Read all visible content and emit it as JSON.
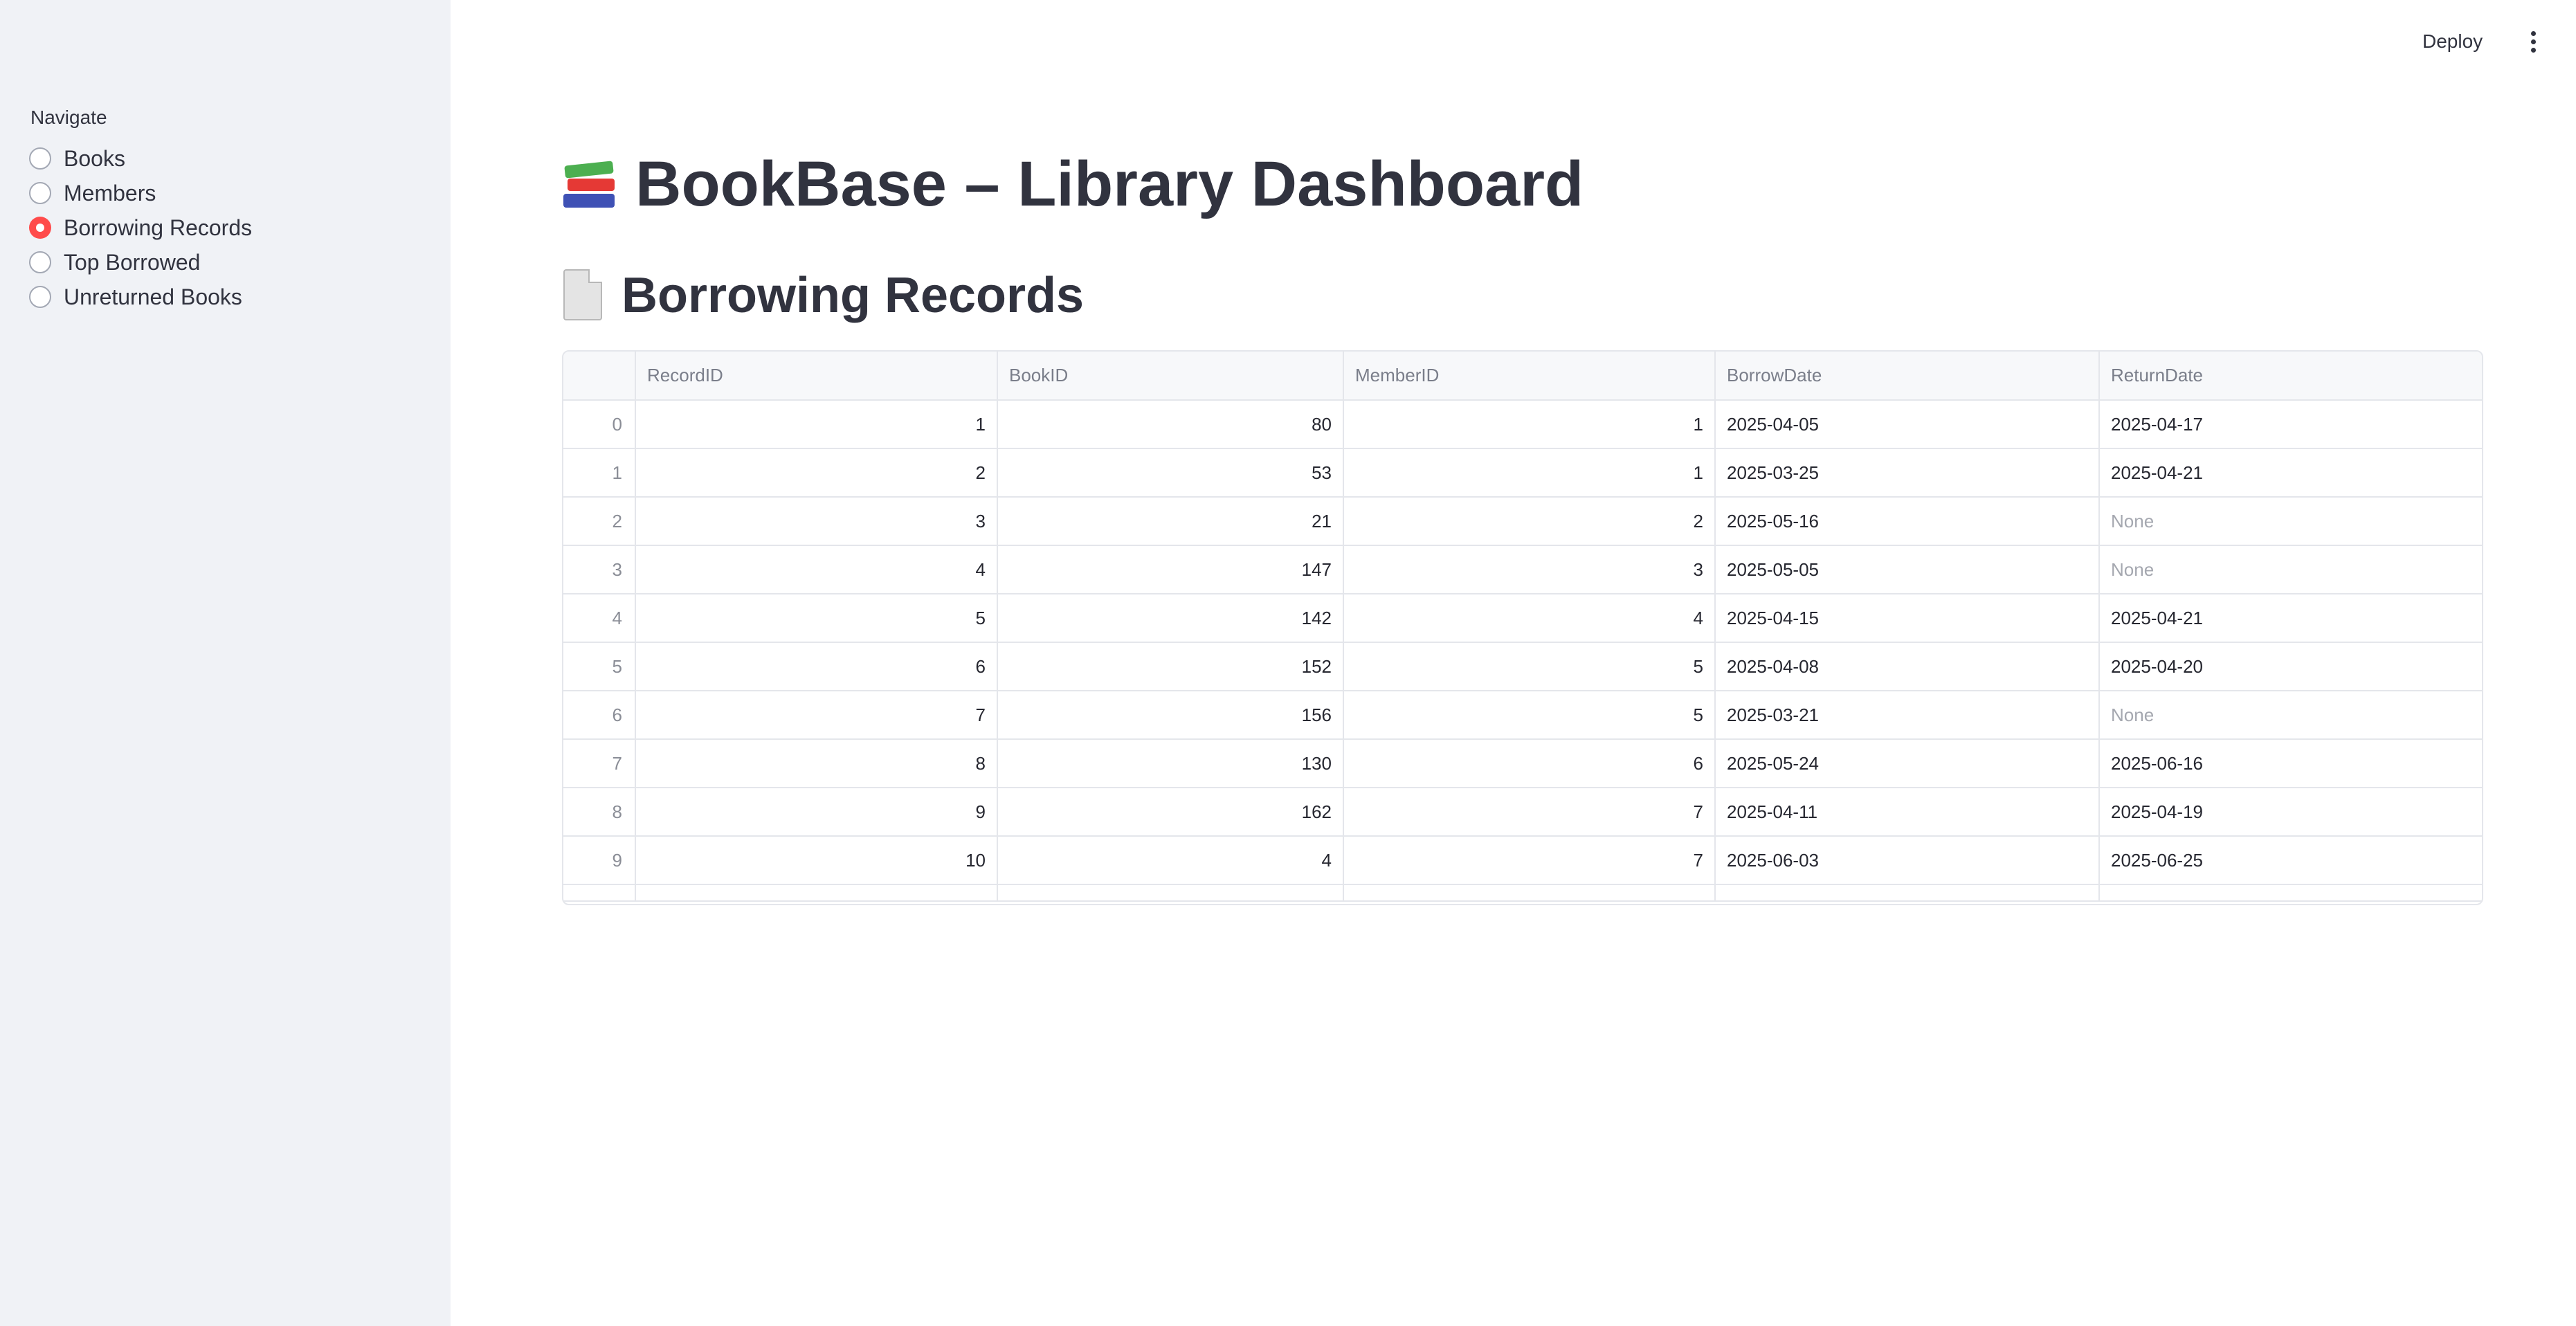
{
  "sidebar": {
    "nav_label": "Navigate",
    "options": [
      {
        "label": "Books",
        "selected": false
      },
      {
        "label": "Members",
        "selected": false
      },
      {
        "label": "Borrowing Records",
        "selected": true
      },
      {
        "label": "Top Borrowed",
        "selected": false
      },
      {
        "label": "Unreturned Books",
        "selected": false
      }
    ]
  },
  "header": {
    "deploy_label": "Deploy",
    "menu_icon": "vertical-ellipsis-icon"
  },
  "main": {
    "title": "BookBase – Library Dashboard",
    "title_icon": "books-emoji-icon",
    "section_title": "Borrowing Records",
    "section_icon": "page-emoji-icon"
  },
  "table": {
    "columns": [
      "",
      "RecordID",
      "BookID",
      "MemberID",
      "BorrowDate",
      "ReturnDate"
    ],
    "rows": [
      [
        "0",
        "1",
        "80",
        "1",
        "2025-04-05",
        "2025-04-17"
      ],
      [
        "1",
        "2",
        "53",
        "1",
        "2025-03-25",
        "2025-04-21"
      ],
      [
        "2",
        "3",
        "21",
        "2",
        "2025-05-16",
        "None"
      ],
      [
        "3",
        "4",
        "147",
        "3",
        "2025-05-05",
        "None"
      ],
      [
        "4",
        "5",
        "142",
        "4",
        "2025-04-15",
        "2025-04-21"
      ],
      [
        "5",
        "6",
        "152",
        "5",
        "2025-04-08",
        "2025-04-20"
      ],
      [
        "6",
        "7",
        "156",
        "5",
        "2025-03-21",
        "None"
      ],
      [
        "7",
        "8",
        "130",
        "6",
        "2025-05-24",
        "2025-06-16"
      ],
      [
        "8",
        "9",
        "162",
        "7",
        "2025-04-11",
        "2025-04-19"
      ],
      [
        "9",
        "10",
        "4",
        "7",
        "2025-06-03",
        "2025-06-25"
      ]
    ]
  },
  "colors": {
    "accent": "#ff4b4b",
    "sidebar_bg": "#f0f2f6",
    "text": "#31333f"
  }
}
